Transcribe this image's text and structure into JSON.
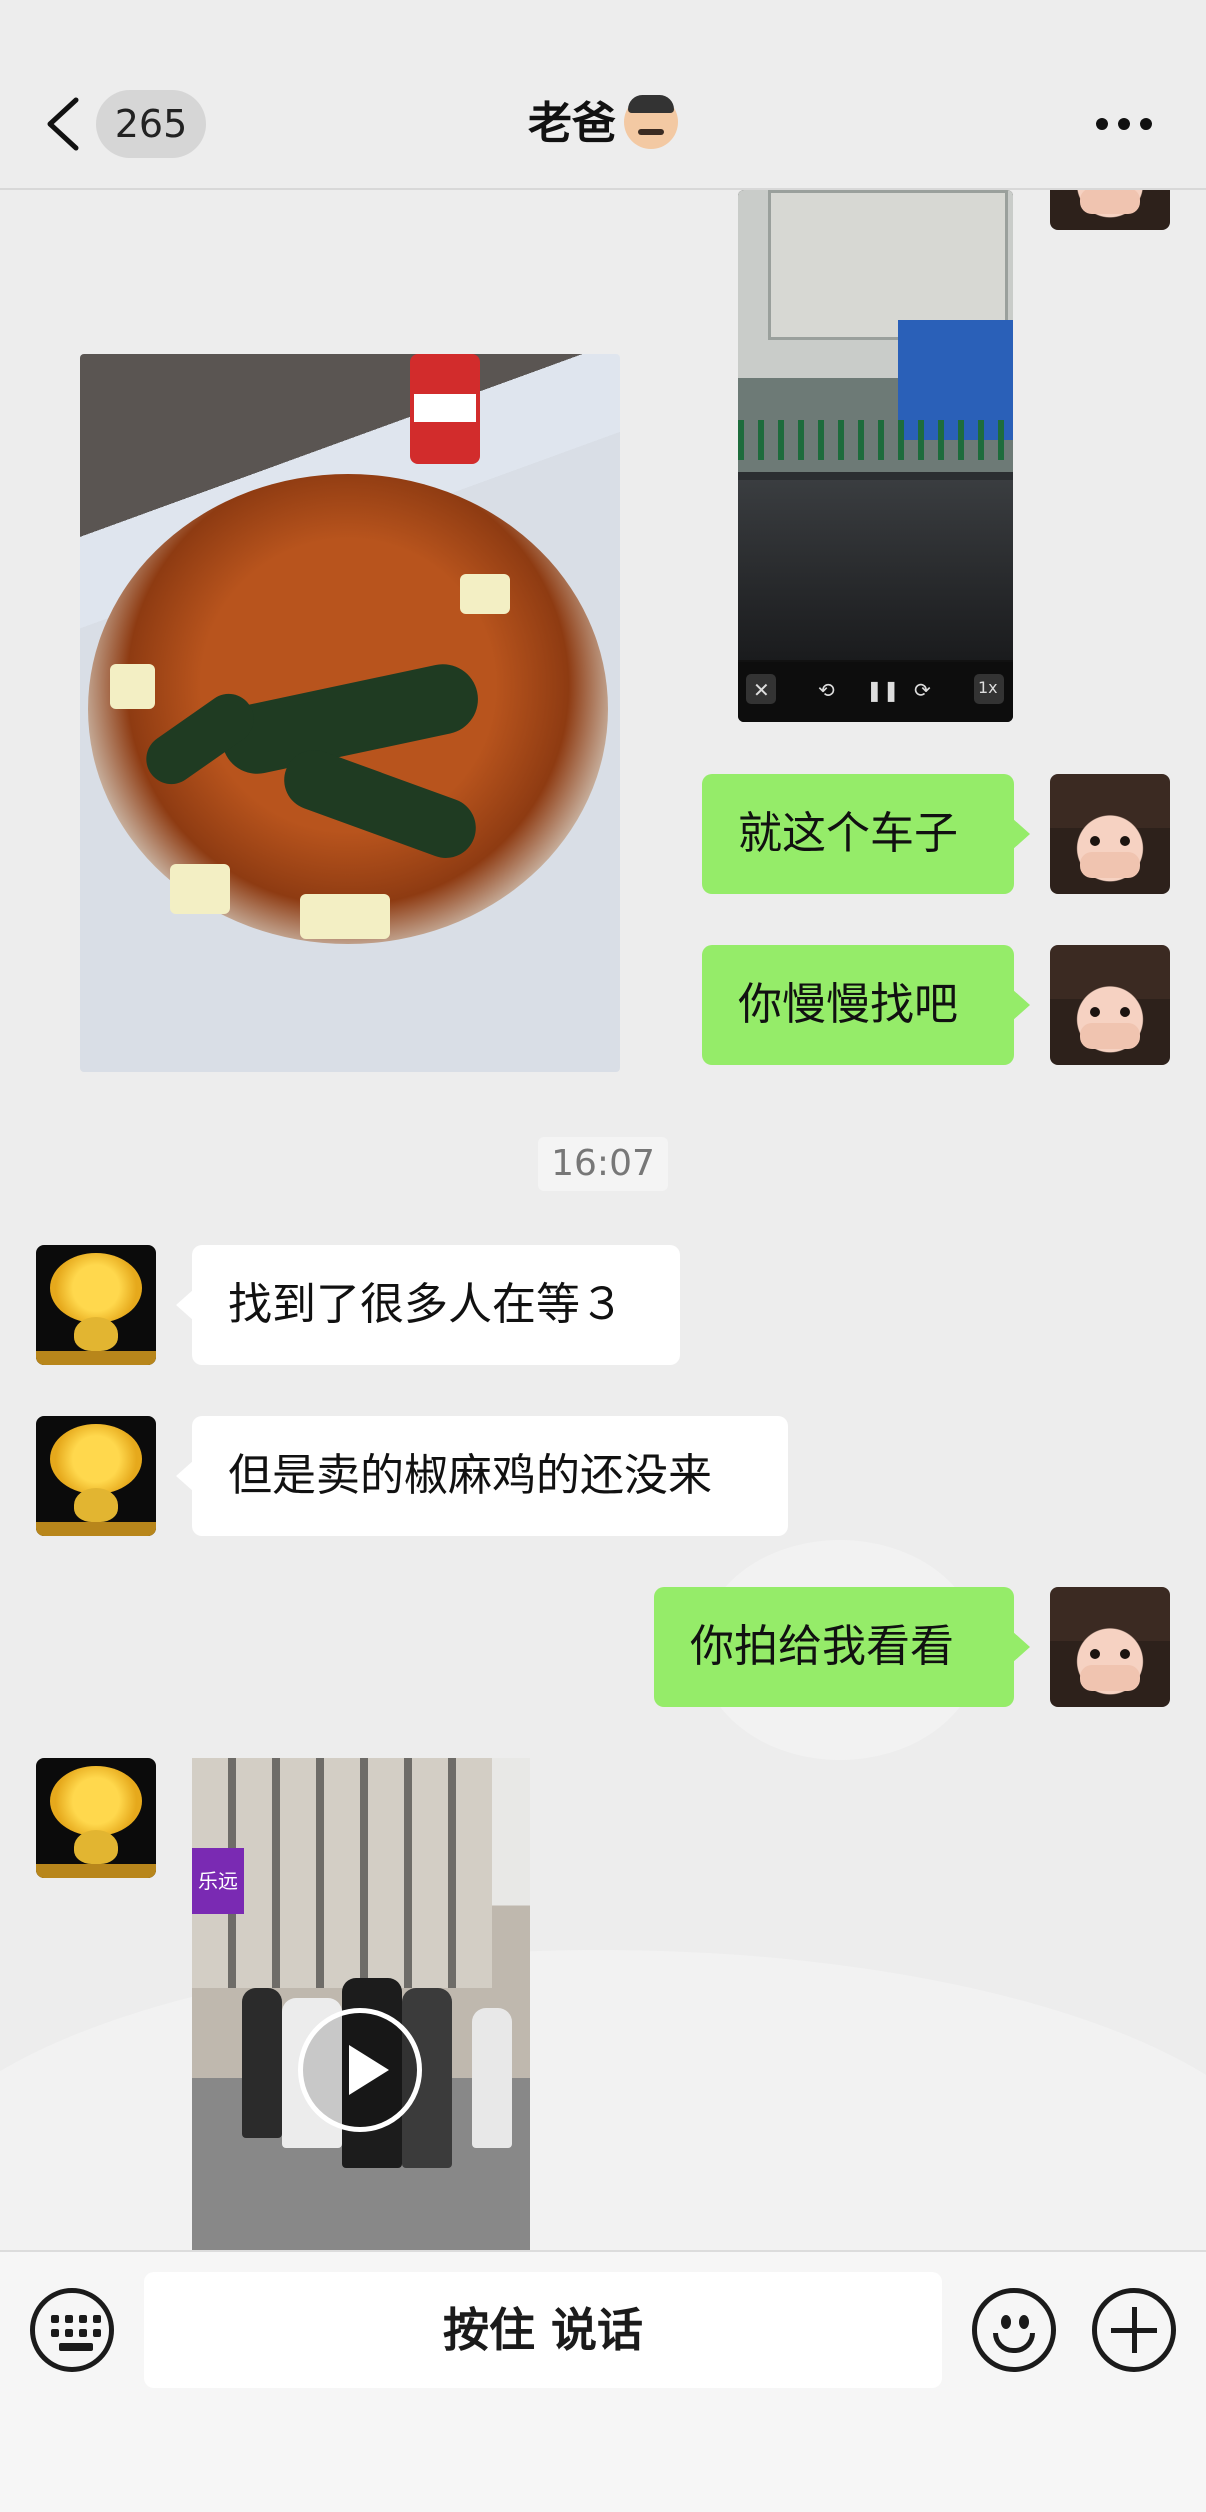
{
  "header": {
    "unread_count": "265",
    "title": "老爸",
    "title_emoji": "man-face-emoji"
  },
  "messages": [
    {
      "side": "left",
      "type": "image",
      "content": "food-photo"
    },
    {
      "side": "right",
      "type": "video",
      "content": "car-window-video"
    },
    {
      "side": "right",
      "type": "text",
      "text": "就这个车子"
    },
    {
      "side": "right",
      "type": "text",
      "text": "你慢慢找吧"
    },
    {
      "type": "time",
      "text": "16:07"
    },
    {
      "side": "left",
      "type": "text",
      "text": "找到了很多人在等３"
    },
    {
      "side": "left",
      "type": "text",
      "text": "但是卖的椒麻鸡的还没来"
    },
    {
      "side": "right",
      "type": "text",
      "text": "你拍给我看看"
    },
    {
      "side": "left",
      "type": "video",
      "content": "street-crowd-video"
    }
  ],
  "video_controls": [
    "✕",
    "⟲",
    "❚❚",
    "⟳",
    "1x"
  ],
  "street_sign_text": "乐远",
  "input_bar": {
    "voice_button_label": "按住 说话",
    "left_icon": "keyboard-icon",
    "right_icons": [
      "emoji-icon",
      "plus-icon"
    ]
  },
  "colors": {
    "self_bubble": "#95ec69",
    "other_bubble": "#ffffff",
    "background": "#ededed"
  }
}
